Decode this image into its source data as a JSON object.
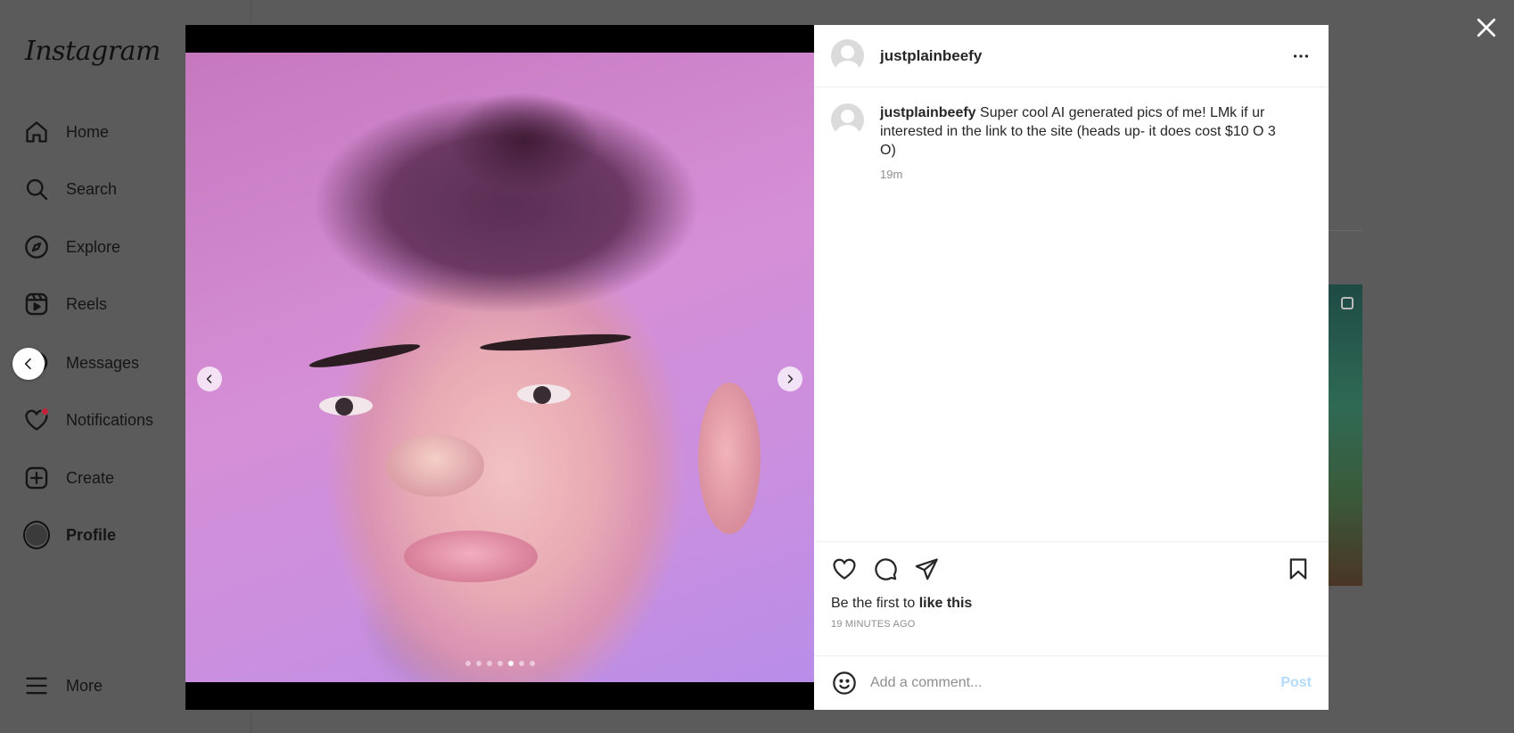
{
  "sidebar": {
    "logo": "Instagram",
    "items": [
      {
        "label": "Home",
        "icon": "home-icon"
      },
      {
        "label": "Search",
        "icon": "search-icon"
      },
      {
        "label": "Explore",
        "icon": "compass-icon"
      },
      {
        "label": "Reels",
        "icon": "reels-icon"
      },
      {
        "label": "Messages",
        "icon": "messenger-icon"
      },
      {
        "label": "Notifications",
        "icon": "heart-icon"
      },
      {
        "label": "Create",
        "icon": "plus-square-icon"
      },
      {
        "label": "Profile",
        "icon": "avatar"
      }
    ],
    "more_label": "More"
  },
  "post": {
    "username": "justplainbeefy",
    "caption_user": "justplainbeefy",
    "caption": " Super cool AI generated pics of me! LMk if ur interested in the link to the site (heads up- it does cost $10 O 3 O)",
    "caption_time": "19m",
    "likes_prefix": "Be the first to ",
    "likes_bold": "like this",
    "timestamp": "19 MINUTES AGO",
    "carousel": {
      "count": 7,
      "active_index": 4
    }
  },
  "comment": {
    "placeholder": "Add a comment...",
    "post_label": "Post"
  },
  "colors": {
    "accent_disabled": "#b3dbff",
    "notification_dot": "#c2213a",
    "overlay": "#5b5b5b"
  }
}
